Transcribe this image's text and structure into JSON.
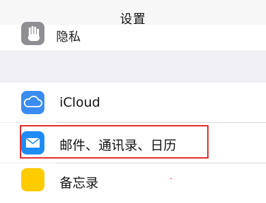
{
  "nav": {
    "title": "设置"
  },
  "peek_row": {
    "label": "隐私",
    "icon": "hand-icon"
  },
  "cells": [
    {
      "label": "iCloud",
      "icon": "cloud-icon",
      "icon_color": "#3b8cf0"
    },
    {
      "label": "邮件、通讯录、日历",
      "icon": "envelope-icon",
      "icon_color": "#1f8cf5"
    },
    {
      "label": "备忘录",
      "icon": "notes-icon",
      "icon_color": "#ffcc00"
    }
  ],
  "colors": {
    "highlight": "#e32a2a",
    "background": "#efeff4"
  }
}
